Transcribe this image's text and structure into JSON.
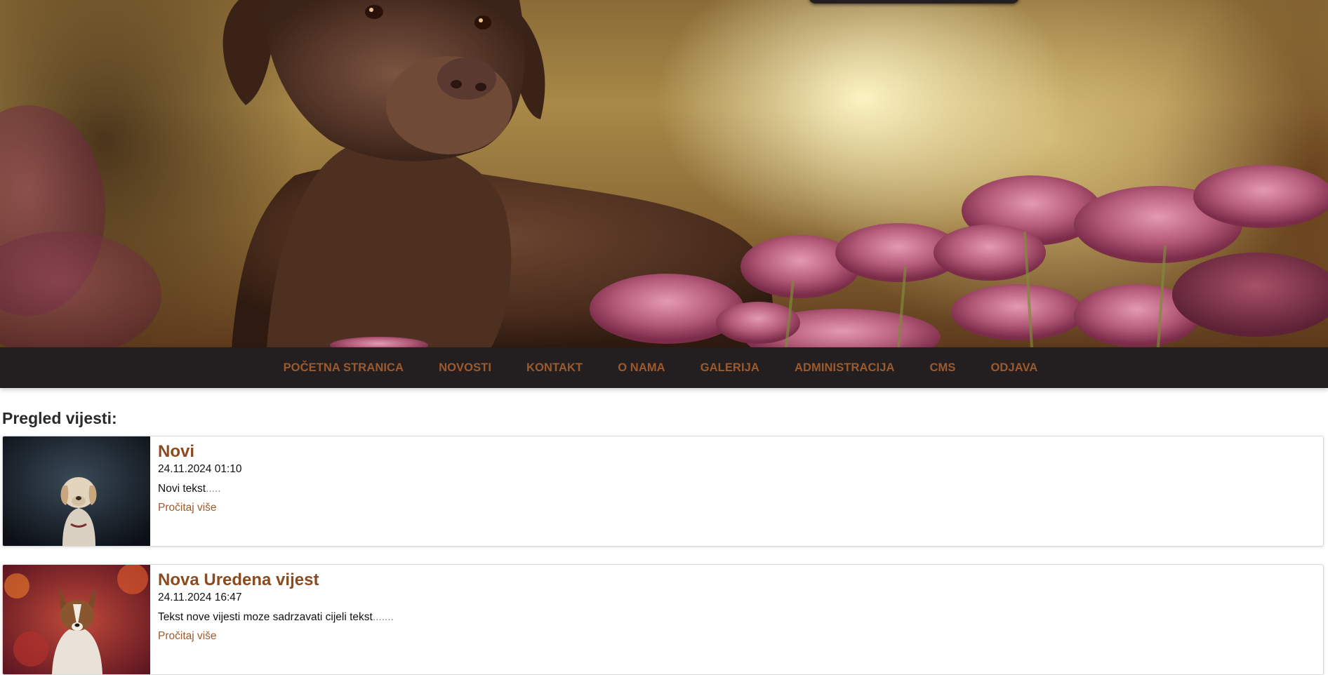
{
  "hero": {
    "image_description_icon": "dog-with-flowers-photo"
  },
  "nav": {
    "items": [
      {
        "label": "POČETNA STRANICA"
      },
      {
        "label": "NOVOSTI"
      },
      {
        "label": "KONTAKT"
      },
      {
        "label": "O NAMA"
      },
      {
        "label": "GALERIJA"
      },
      {
        "label": "ADMINISTRACIJA"
      },
      {
        "label": "CMS"
      },
      {
        "label": "ODJAVA"
      }
    ]
  },
  "main": {
    "heading": "Pregled vijesti:",
    "news": [
      {
        "title": "Novi",
        "date": "24.11.2024 01:10",
        "excerpt": "Novi tekst",
        "excerpt_suffix": ".....",
        "more_label": "Pročitaj više",
        "thumb_icon": "dog-portrait-photo"
      },
      {
        "title": "Nova Uredena vijest",
        "date": "24.11.2024 16:47",
        "excerpt": "Tekst nove vijesti moze sadrzavati cijeli tekst",
        "excerpt_suffix": ".......",
        "more_label": "Pročitaj više",
        "thumb_icon": "corgi-autumn-photo"
      }
    ]
  },
  "colors": {
    "nav_bg": "#231f20",
    "accent": "#9c5a2c",
    "title": "#8b4b20"
  }
}
